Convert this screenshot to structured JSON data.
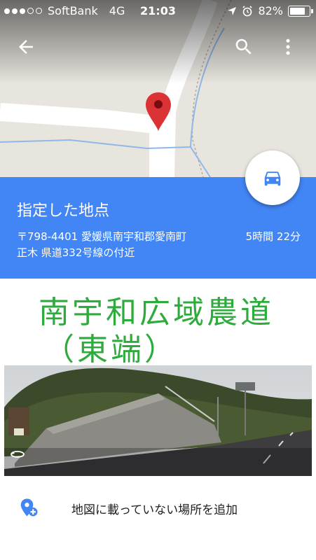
{
  "status_bar": {
    "carrier": "SoftBank",
    "network": "4G",
    "time": "21:03",
    "battery_percent": "82%",
    "battery_level": 0.82
  },
  "toolbar": {
    "back_icon": "arrow-left-icon",
    "search_icon": "search-icon",
    "more_icon": "more-vert-icon"
  },
  "place": {
    "title": "指定した地点",
    "address_line1": "〒798-4401 愛媛県南宇和郡愛南町",
    "address_line2": "正木 県道332号線の付近",
    "duration": "5時間 22分"
  },
  "annotation": {
    "line1": "南宇和広域農道",
    "line2": "（東端）"
  },
  "add_place": {
    "label": "地図に載っていない場所を追加"
  },
  "colors": {
    "primary": "#4285f4",
    "marker": "#db3236",
    "handwriting": "#2eab3c"
  }
}
